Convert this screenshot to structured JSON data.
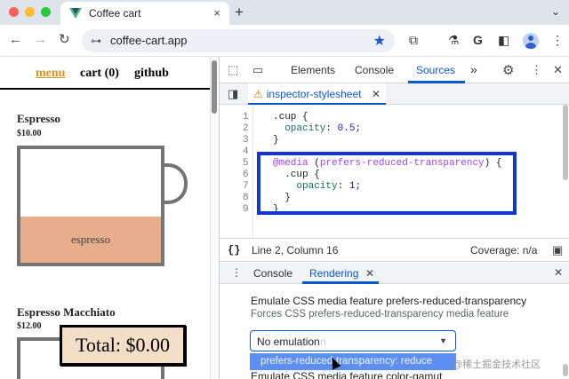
{
  "browser": {
    "tab_title": "Coffee cart",
    "tab_close": "×",
    "new_tab": "+",
    "tab_list": "⌄",
    "url": "coffee-cart.app",
    "back": "←",
    "forward": "→",
    "reload": "↻",
    "site_info": "⊶",
    "star": "★",
    "extensions": "⧉",
    "labs": "⚗",
    "google": "G",
    "sidepanel": "◧",
    "menu": "⋮",
    "colors": {
      "red": "#ff5f57",
      "yellow": "#febc2e",
      "green": "#28c840",
      "accent": "#0b57d0"
    }
  },
  "site": {
    "nav": {
      "menu": "menu",
      "cart": "cart (0)",
      "github": "github"
    },
    "products": [
      {
        "name": "Espresso",
        "price": "$10.00",
        "fill_label": "espresso"
      },
      {
        "name": "Espresso Macchiato",
        "price": "$12.00"
      }
    ],
    "total": "Total: $0.00"
  },
  "devtools": {
    "tabs": {
      "elements": "Elements",
      "console": "Console",
      "sources": "Sources",
      "more": "»"
    },
    "inspect_icon": "⬚",
    "device_icon": "▭",
    "settings_icon": "⚙",
    "menu_icon": "⋮",
    "close_icon": "✕",
    "panel_toggle": "◨",
    "file_tab": {
      "warning": "⚠",
      "name": "inspector-stylesheet",
      "close": "✕"
    },
    "code": {
      "line_numbers": [
        "1",
        "2",
        "3",
        "4",
        "5",
        "6",
        "7",
        "8",
        "9"
      ],
      "l1": ".cup {",
      "l2_prop": "opacity",
      "l2_val": "0.5",
      "l3": "}",
      "l5_at": "@media",
      "l5_feature": "prefers-reduced-transparency",
      "l6": ".cup {",
      "l7_prop": "opacity",
      "l7_val": "1",
      "l8": "}",
      "l9": "}"
    },
    "status": {
      "braces": "{}",
      "position": "Line 2, Column 16",
      "coverage": "Coverage: n/a",
      "icon": "▣"
    },
    "drawer": {
      "menu": "⋮",
      "console_tab": "Console",
      "rendering_tab": "Rendering",
      "rendering_close": "✕",
      "close": "✕",
      "emul_title": "Emulate CSS media feature prefers-reduced-transparency",
      "emul_desc": "Forces CSS prefers-reduced-transparency media feature",
      "select_value": "No emulation",
      "select_ghost": "n",
      "select_arrow": "▼",
      "dropdown_option": "prefers-reduced-transparency: reduce",
      "next_label": "Emulate CSS media feature color-gamut",
      "watermark": "@稀土掘金技术社区"
    }
  }
}
